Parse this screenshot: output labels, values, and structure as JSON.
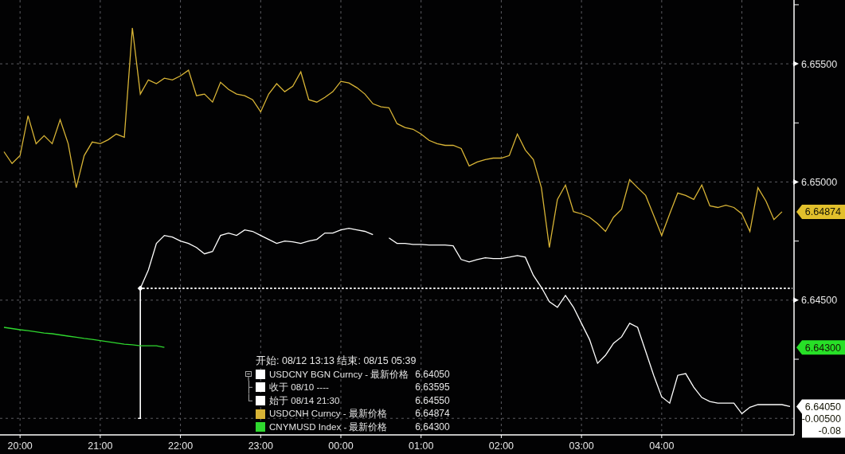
{
  "chart": {
    "chart_data": {
      "type": "line",
      "grid": true,
      "categories": [
        null,
        null,
        "20:00",
        null,
        null,
        null,
        null,
        null,
        null,
        null,
        null,
        null,
        "21:00",
        null,
        null,
        null,
        null,
        null,
        null,
        null,
        null,
        null,
        "22:00",
        null,
        null,
        null,
        null,
        null,
        null,
        null,
        null,
        null,
        "23:00",
        null,
        null,
        null,
        null,
        null,
        null,
        null,
        null,
        null,
        "00:00",
        null,
        null,
        null,
        null,
        null,
        null,
        null,
        null,
        null,
        "01:00",
        null,
        null,
        null,
        null,
        null,
        null,
        null,
        null,
        null,
        "02:00",
        null,
        null,
        null,
        null,
        null,
        null,
        null,
        null,
        null,
        "03:00",
        null,
        null,
        null,
        null,
        null,
        null,
        null,
        null,
        null,
        "04:00",
        null,
        null,
        null,
        null,
        null,
        null,
        null,
        null,
        null,
        null,
        null,
        null,
        null,
        null,
        null,
        null
      ],
      "series": [
        {
          "name": "USDCNY BGN Curncy - 最新价格",
          "color": "#ffffff",
          "values": [
            null,
            null,
            null,
            null,
            null,
            null,
            null,
            null,
            null,
            null,
            null,
            null,
            null,
            null,
            null,
            null,
            null,
            6.6455,
            6.64628,
            6.6474,
            6.64774,
            6.64767,
            6.6475,
            6.6474,
            6.64723,
            6.64696,
            6.64706,
            6.64774,
            6.64784,
            6.64774,
            6.64797,
            6.64791,
            6.64774,
            6.64757,
            6.6474,
            6.6475,
            6.64747,
            6.6474,
            6.6475,
            6.64757,
            6.64784,
            6.64784,
            6.64797,
            6.64804,
            6.64797,
            6.64791,
            6.64777,
            null,
            6.64763,
            6.6474,
            6.6474,
            6.64736,
            6.64736,
            6.64733,
            6.64733,
            6.64733,
            6.6473,
            6.64672,
            6.64662,
            6.64672,
            6.64679,
            6.64676,
            6.64676,
            6.64682,
            6.64689,
            6.64682,
            6.64605,
            6.64554,
            6.64493,
            6.6447,
            6.6452,
            6.6447,
            6.64402,
            6.64334,
            6.64233,
            6.64267,
            6.64318,
            6.64345,
            6.64402,
            6.64385,
            6.64284,
            6.64182,
            6.64091,
            6.64064,
            6.64182,
            6.64189,
            6.64132,
            6.64088,
            6.64071,
            6.64064,
            6.64064,
            6.64064,
            6.6402,
            6.64047,
            6.64058,
            6.64058,
            6.64058,
            6.64058,
            6.6405
          ]
        },
        {
          "name": "USDCNH Curncy - 最新价格",
          "color": "#d8b436",
          "values": [
            6.65128,
            6.65078,
            6.65112,
            6.6528,
            6.65162,
            6.65196,
            6.65162,
            6.65264,
            6.65162,
            6.64976,
            6.65112,
            6.65169,
            6.65162,
            6.65179,
            6.65203,
            6.65189,
            6.65652,
            6.65372,
            6.65432,
            6.65416,
            6.65439,
            6.65432,
            6.65449,
            6.65473,
            6.65365,
            6.65372,
            6.65338,
            6.65422,
            6.65392,
            6.65372,
            6.65365,
            6.65348,
            6.65297,
            6.65372,
            6.65416,
            6.65382,
            6.65405,
            6.65466,
            6.65348,
            6.65338,
            6.65358,
            6.65382,
            6.65426,
            6.65419,
            6.65399,
            6.65372,
            6.65331,
            6.65318,
            6.65314,
            6.65247,
            6.6523,
            6.65223,
            6.65203,
            6.65176,
            6.65162,
            6.65155,
            6.65155,
            6.65142,
            6.65068,
            6.65085,
            6.65095,
            6.65101,
            6.65101,
            6.65112,
            6.65203,
            6.65135,
            6.65095,
            6.64976,
            6.64723,
            6.64926,
            6.64987,
            6.64875,
            6.64865,
            6.64851,
            6.64824,
            6.64791,
            6.64851,
            6.64885,
            6.6501,
            6.64976,
            6.64943,
            6.64858,
            6.64774,
            6.64865,
            6.64953,
            6.64943,
            6.64926,
            6.64987,
            6.64899,
            6.64892,
            6.64902,
            6.64892,
            6.64865,
            6.64791,
            6.64976,
            6.64919,
            6.64841,
            6.64874,
            null
          ]
        },
        {
          "name": "CNYMUSD Index - 最新价格",
          "color": "#2fd82f",
          "values": [
            6.64385,
            6.6438,
            6.64375,
            6.64371,
            6.64366,
            6.64361,
            6.64358,
            6.64353,
            6.64348,
            6.64343,
            6.64338,
            6.64334,
            6.64329,
            6.64324,
            6.64319,
            6.64314,
            6.64311,
            6.64307,
            6.64307,
            6.64307,
            6.643,
            null,
            null,
            null,
            null,
            null,
            null,
            null,
            null,
            null,
            null,
            null,
            null,
            null,
            null,
            null,
            null,
            null,
            null,
            null,
            null,
            null,
            null,
            null,
            null,
            null,
            null,
            null,
            null,
            null,
            null,
            null,
            null,
            null,
            null,
            null,
            null,
            null,
            null,
            null,
            null,
            null,
            null,
            null,
            null,
            null,
            null,
            null,
            null,
            null,
            null,
            null,
            null,
            null,
            null,
            null,
            null,
            null,
            null,
            null,
            null,
            null,
            null,
            null,
            null,
            null,
            null,
            null,
            null,
            null,
            null,
            null,
            null,
            null,
            null,
            null,
            null,
            null,
            null
          ]
        }
      ],
      "ylim": [
        6.6393,
        6.6577
      ],
      "yticks": [
        {
          "value": 6.645,
          "label": "6.64500"
        },
        {
          "value": 6.65,
          "label": "6.65000"
        },
        {
          "value": 6.655,
          "label": "6.65500"
        }
      ],
      "ref_lines": [
        {
          "axis": "y",
          "value": 6.6455
        }
      ]
    },
    "price_tags": [
      {
        "label": "6.64874",
        "color": "#e2c02c"
      },
      {
        "label": "6.64300",
        "color": "#27e027"
      },
      {
        "label": "6.64050",
        "color": "#ffffff",
        "change": "-0.00500",
        "change_pct": "-0.08"
      }
    ]
  },
  "legend": {
    "header": "开始: 08/12 13:13 结束: 08/15 05:39",
    "items": [
      {
        "value": "6.64050",
        "expanded": true,
        "children": [
          {
            "label": "收于 08/10 ----",
            "value": "6.63595",
            "color": "#ffffff"
          },
          {
            "label": "始于 08/14 21:30",
            "value": "6.64550",
            "color": "#ffffff"
          }
        ]
      },
      {
        "value": "6.64874"
      },
      {
        "value": "6.64300"
      }
    ]
  }
}
